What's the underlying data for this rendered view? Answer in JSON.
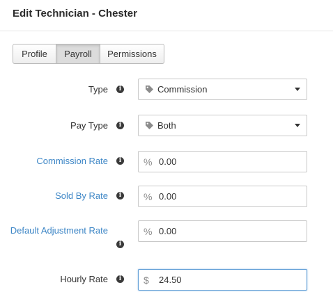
{
  "title": "Edit Technician - Chester",
  "tabs": [
    {
      "label": "Profile"
    },
    {
      "label": "Payroll"
    },
    {
      "label": "Permissions"
    }
  ],
  "fields": {
    "type": {
      "label": "Type",
      "value": "Commission"
    },
    "pay_type": {
      "label": "Pay Type",
      "value": "Both"
    },
    "commission_rate": {
      "label": "Commission Rate",
      "prefix": "%",
      "value": "0.00"
    },
    "sold_by_rate": {
      "label": "Sold By Rate",
      "prefix": "%",
      "value": "0.00"
    },
    "default_adjustment_rate": {
      "label": "Default Adjustment Rate",
      "prefix": "%",
      "value": "0.00"
    },
    "hourly_rate": {
      "label": "Hourly Rate",
      "prefix": "$",
      "value": "24.50"
    }
  },
  "info_icon_glyph": "i",
  "colors": {
    "link_label": "#3d86c6",
    "active_tab": "#dcdcdc",
    "focus_border": "#5b9bd5"
  }
}
